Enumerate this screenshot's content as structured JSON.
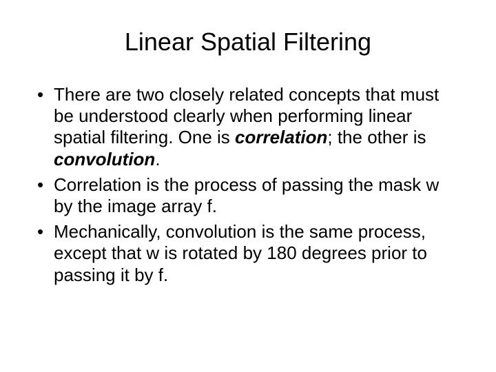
{
  "title": "Linear Spatial Filtering",
  "bullets": {
    "b1_pre": "There are two closely related concepts that must be understood clearly when performing linear spatial filtering. One is ",
    "b1_em1": "correlation",
    "b1_mid": "; the other is ",
    "b1_em2": "convolution",
    "b1_post": ".",
    "b2": "Correlation is the process of passing the mask w by the image array f.",
    "b3": "Mechanically, convolution is the same process, except that w is rotated by 180 degrees prior to passing it by f."
  }
}
